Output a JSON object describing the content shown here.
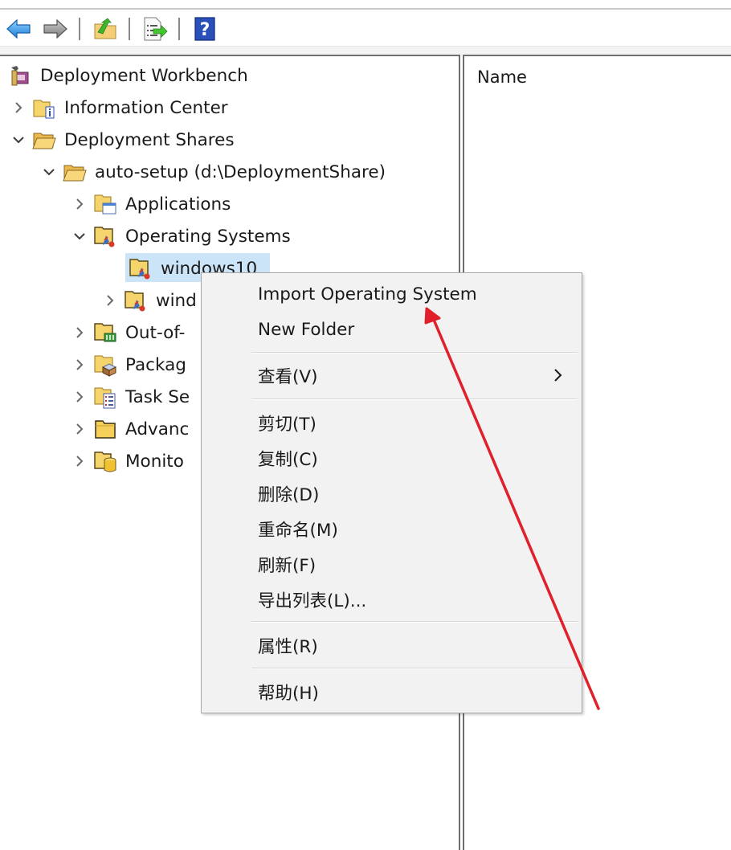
{
  "toolbar": {
    "buttons": [
      {
        "name": "back",
        "icon": "back-arrow-icon"
      },
      {
        "name": "forward",
        "icon": "forward-arrow-icon"
      },
      {
        "name": "up-one-level",
        "icon": "folder-up-icon"
      },
      {
        "name": "export-list",
        "icon": "export-list-icon"
      },
      {
        "name": "help",
        "icon": "help-icon",
        "glyph": "?"
      }
    ]
  },
  "tree": {
    "root": {
      "label": "Deployment Workbench",
      "icon": "workbench-icon"
    },
    "nodes": [
      {
        "label": "Information Center",
        "icon": "folder-info-icon",
        "expanded": false,
        "level": 1
      },
      {
        "label": "Deployment Shares",
        "icon": "folder-open-icon",
        "expanded": true,
        "level": 1
      },
      {
        "label": "auto-setup (d:\\DeploymentShare)",
        "icon": "folder-open-icon",
        "expanded": true,
        "level": 2
      },
      {
        "label": "Applications",
        "icon": "folder-applications-icon",
        "expanded": false,
        "level": 3
      },
      {
        "label": "Operating Systems",
        "icon": "folder-os-icon",
        "expanded": true,
        "level": 3
      },
      {
        "label": "windows10",
        "icon": "folder-os-icon",
        "expanded": null,
        "level": 4,
        "selected": true
      },
      {
        "label": "wind",
        "icon": "folder-os-icon",
        "expanded": false,
        "level": 4
      },
      {
        "label": "Out-of-",
        "icon": "folder-drivers-icon",
        "expanded": false,
        "level": 3
      },
      {
        "label": "Packag",
        "icon": "folder-packages-icon",
        "expanded": false,
        "level": 3
      },
      {
        "label": "Task Se",
        "icon": "folder-task-sequences-icon",
        "expanded": false,
        "level": 3
      },
      {
        "label": "Advanc",
        "icon": "folder-icon",
        "expanded": false,
        "level": 3
      },
      {
        "label": "Monito",
        "icon": "folder-monitoring-icon",
        "expanded": false,
        "level": 3
      }
    ]
  },
  "list": {
    "columns": [
      "Name"
    ]
  },
  "context_menu": {
    "items": [
      {
        "label": "Import Operating System"
      },
      {
        "label": "New Folder"
      },
      {
        "separator": true
      },
      {
        "label": "查看(V)",
        "submenu": true
      },
      {
        "separator": true
      },
      {
        "label": "剪切(T)"
      },
      {
        "label": "复制(C)"
      },
      {
        "label": "删除(D)"
      },
      {
        "label": "重命名(M)"
      },
      {
        "label": "刷新(F)"
      },
      {
        "label": "导出列表(L)..."
      },
      {
        "separator": true
      },
      {
        "label": "属性(R)"
      },
      {
        "separator": true
      },
      {
        "label": "帮助(H)"
      }
    ]
  },
  "annotation": {
    "type": "arrow",
    "color": "#e0202a",
    "points_to": "Import Operating System"
  },
  "colors": {
    "selection": "#cce4f7",
    "menu_background": "#f2f2f2",
    "annotation_red": "#e0202a"
  }
}
